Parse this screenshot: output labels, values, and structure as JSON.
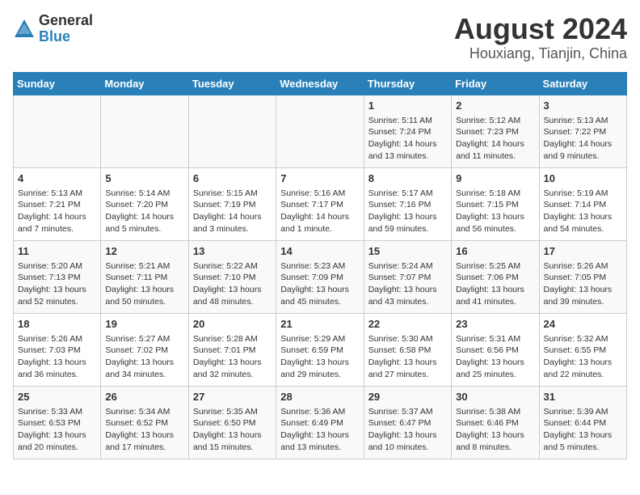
{
  "header": {
    "logo_line1": "General",
    "logo_line2": "Blue",
    "title": "August 2024",
    "subtitle": "Houxiang, Tianjin, China"
  },
  "days_of_week": [
    "Sunday",
    "Monday",
    "Tuesday",
    "Wednesday",
    "Thursday",
    "Friday",
    "Saturday"
  ],
  "weeks": [
    [
      {
        "day": "",
        "info": ""
      },
      {
        "day": "",
        "info": ""
      },
      {
        "day": "",
        "info": ""
      },
      {
        "day": "",
        "info": ""
      },
      {
        "day": "1",
        "info": "Sunrise: 5:11 AM\nSunset: 7:24 PM\nDaylight: 14 hours\nand 13 minutes."
      },
      {
        "day": "2",
        "info": "Sunrise: 5:12 AM\nSunset: 7:23 PM\nDaylight: 14 hours\nand 11 minutes."
      },
      {
        "day": "3",
        "info": "Sunrise: 5:13 AM\nSunset: 7:22 PM\nDaylight: 14 hours\nand 9 minutes."
      }
    ],
    [
      {
        "day": "4",
        "info": "Sunrise: 5:13 AM\nSunset: 7:21 PM\nDaylight: 14 hours\nand 7 minutes."
      },
      {
        "day": "5",
        "info": "Sunrise: 5:14 AM\nSunset: 7:20 PM\nDaylight: 14 hours\nand 5 minutes."
      },
      {
        "day": "6",
        "info": "Sunrise: 5:15 AM\nSunset: 7:19 PM\nDaylight: 14 hours\nand 3 minutes."
      },
      {
        "day": "7",
        "info": "Sunrise: 5:16 AM\nSunset: 7:17 PM\nDaylight: 14 hours\nand 1 minute."
      },
      {
        "day": "8",
        "info": "Sunrise: 5:17 AM\nSunset: 7:16 PM\nDaylight: 13 hours\nand 59 minutes."
      },
      {
        "day": "9",
        "info": "Sunrise: 5:18 AM\nSunset: 7:15 PM\nDaylight: 13 hours\nand 56 minutes."
      },
      {
        "day": "10",
        "info": "Sunrise: 5:19 AM\nSunset: 7:14 PM\nDaylight: 13 hours\nand 54 minutes."
      }
    ],
    [
      {
        "day": "11",
        "info": "Sunrise: 5:20 AM\nSunset: 7:13 PM\nDaylight: 13 hours\nand 52 minutes."
      },
      {
        "day": "12",
        "info": "Sunrise: 5:21 AM\nSunset: 7:11 PM\nDaylight: 13 hours\nand 50 minutes."
      },
      {
        "day": "13",
        "info": "Sunrise: 5:22 AM\nSunset: 7:10 PM\nDaylight: 13 hours\nand 48 minutes."
      },
      {
        "day": "14",
        "info": "Sunrise: 5:23 AM\nSunset: 7:09 PM\nDaylight: 13 hours\nand 45 minutes."
      },
      {
        "day": "15",
        "info": "Sunrise: 5:24 AM\nSunset: 7:07 PM\nDaylight: 13 hours\nand 43 minutes."
      },
      {
        "day": "16",
        "info": "Sunrise: 5:25 AM\nSunset: 7:06 PM\nDaylight: 13 hours\nand 41 minutes."
      },
      {
        "day": "17",
        "info": "Sunrise: 5:26 AM\nSunset: 7:05 PM\nDaylight: 13 hours\nand 39 minutes."
      }
    ],
    [
      {
        "day": "18",
        "info": "Sunrise: 5:26 AM\nSunset: 7:03 PM\nDaylight: 13 hours\nand 36 minutes."
      },
      {
        "day": "19",
        "info": "Sunrise: 5:27 AM\nSunset: 7:02 PM\nDaylight: 13 hours\nand 34 minutes."
      },
      {
        "day": "20",
        "info": "Sunrise: 5:28 AM\nSunset: 7:01 PM\nDaylight: 13 hours\nand 32 minutes."
      },
      {
        "day": "21",
        "info": "Sunrise: 5:29 AM\nSunset: 6:59 PM\nDaylight: 13 hours\nand 29 minutes."
      },
      {
        "day": "22",
        "info": "Sunrise: 5:30 AM\nSunset: 6:58 PM\nDaylight: 13 hours\nand 27 minutes."
      },
      {
        "day": "23",
        "info": "Sunrise: 5:31 AM\nSunset: 6:56 PM\nDaylight: 13 hours\nand 25 minutes."
      },
      {
        "day": "24",
        "info": "Sunrise: 5:32 AM\nSunset: 6:55 PM\nDaylight: 13 hours\nand 22 minutes."
      }
    ],
    [
      {
        "day": "25",
        "info": "Sunrise: 5:33 AM\nSunset: 6:53 PM\nDaylight: 13 hours\nand 20 minutes."
      },
      {
        "day": "26",
        "info": "Sunrise: 5:34 AM\nSunset: 6:52 PM\nDaylight: 13 hours\nand 17 minutes."
      },
      {
        "day": "27",
        "info": "Sunrise: 5:35 AM\nSunset: 6:50 PM\nDaylight: 13 hours\nand 15 minutes."
      },
      {
        "day": "28",
        "info": "Sunrise: 5:36 AM\nSunset: 6:49 PM\nDaylight: 13 hours\nand 13 minutes."
      },
      {
        "day": "29",
        "info": "Sunrise: 5:37 AM\nSunset: 6:47 PM\nDaylight: 13 hours\nand 10 minutes."
      },
      {
        "day": "30",
        "info": "Sunrise: 5:38 AM\nSunset: 6:46 PM\nDaylight: 13 hours\nand 8 minutes."
      },
      {
        "day": "31",
        "info": "Sunrise: 5:39 AM\nSunset: 6:44 PM\nDaylight: 13 hours\nand 5 minutes."
      }
    ]
  ]
}
